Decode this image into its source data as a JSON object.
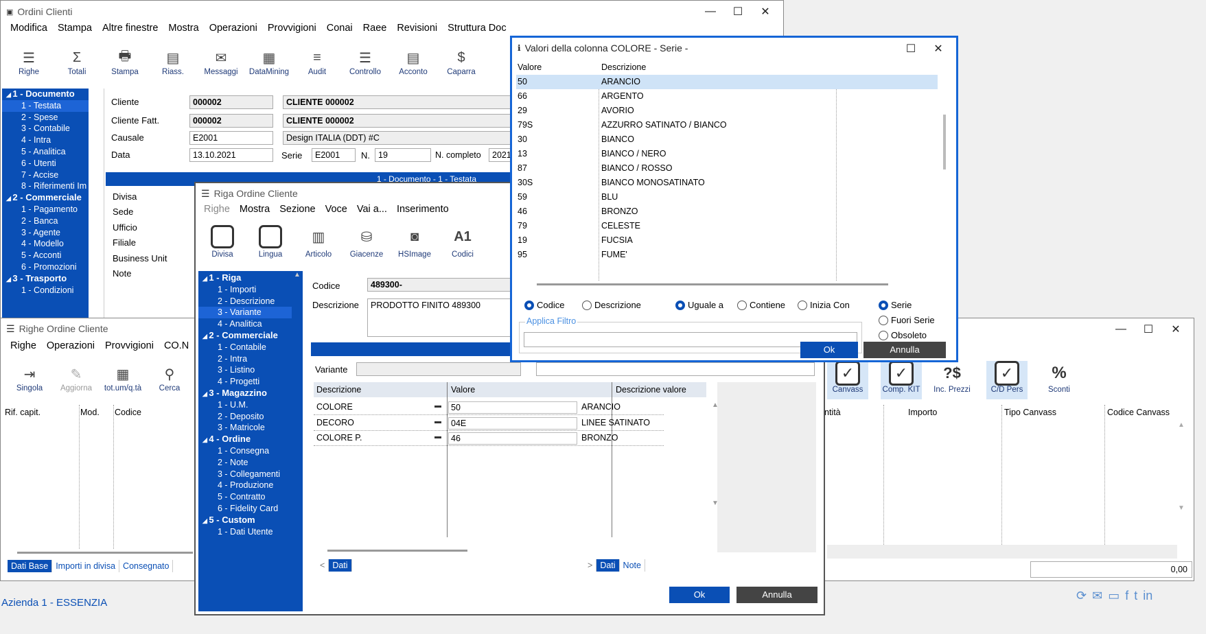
{
  "main": {
    "title": "Ordini Clienti",
    "menu": [
      "Modifica",
      "Stampa",
      "Altre finestre",
      "Mostra",
      "Operazioni",
      "Provvigioni",
      "Conai",
      "Raee",
      "Revisioni",
      "Struttura Doc"
    ],
    "toolbar": [
      "Righe",
      "Totali",
      "Stampa",
      "Riass.",
      "Messaggi",
      "DataMining",
      "Audit",
      "Controllo",
      "Acconto",
      "Caparra"
    ],
    "tree": [
      {
        "label": "1 - Documento",
        "group": true
      },
      {
        "label": "1 - Testata",
        "selected": true
      },
      {
        "label": "2 - Spese"
      },
      {
        "label": "3 - Contabile"
      },
      {
        "label": "4 - Intra"
      },
      {
        "label": "5 - Analitica"
      },
      {
        "label": "6 - Utenti"
      },
      {
        "label": "7 - Accise"
      },
      {
        "label": "8 - Riferimenti Im"
      },
      {
        "label": "2 - Commerciale",
        "group": true
      },
      {
        "label": "1 - Pagamento"
      },
      {
        "label": "2 - Banca"
      },
      {
        "label": "3 - Agente"
      },
      {
        "label": "4 - Modello"
      },
      {
        "label": "5 - Acconti"
      },
      {
        "label": "6 - Promozioni"
      },
      {
        "label": "3 - Trasporto",
        "group": true
      },
      {
        "label": "1 - Condizioni"
      }
    ],
    "cliente_label": "Cliente",
    "cliente_code": "000002",
    "cliente_name": "CLIENTE 000002",
    "cliente_fatt_label": "Cliente Fatt.",
    "cliente_fatt_code": "000002",
    "cliente_fatt_name": "CLIENTE 000002",
    "causale_label": "Causale",
    "causale_code": "E2001",
    "causale_desc": "Design ITALIA (DDT) #C",
    "data_label": "Data",
    "data_value": "13.10.2021",
    "serie_label": "Serie",
    "serie_value": "E2001",
    "n_label": "N.",
    "n_value": "19",
    "ncompleto_label": "N. completo",
    "ncompleto_value": "2021",
    "breadcrumb": "1 - Documento - 1 - Testata",
    "side_labels": [
      "Divisa",
      "Sede",
      "Ufficio",
      "Filiale",
      "Business Unit",
      "Note"
    ]
  },
  "righe": {
    "title": "Righe  Ordine Cliente",
    "menu": [
      "Righe",
      "Operazioni",
      "Provvigioni",
      "CO.N"
    ],
    "toolbar": [
      "Singola",
      "Aggiorna",
      "tot.um/q.tà",
      "Cerca"
    ],
    "columns": [
      "Rif. capit.",
      "Mod.",
      "Codice"
    ],
    "right_buttons": [
      "Canvass",
      "Comp. KIT",
      "Inc. Prezzi",
      "C/D Pers",
      "Sconti"
    ],
    "right_columns": [
      "ntità",
      "Importo",
      "Tipo Canvass",
      "Codice Canvass"
    ],
    "tabs": [
      "Dati Base",
      "Importi in divisa",
      "Consegnato"
    ],
    "total": "0,00"
  },
  "riga": {
    "title": "Riga Ordine Cliente",
    "menu": [
      "Righe",
      "Mostra",
      "Sezione",
      "Voce",
      "Vai a...",
      "Inserimento"
    ],
    "toolbar": [
      "Divisa",
      "Lingua",
      "Articolo",
      "Giacenze",
      "HSImage",
      "Codici"
    ],
    "tree": [
      {
        "label": "1 - Riga",
        "group": true
      },
      {
        "label": "1 - Importi"
      },
      {
        "label": "2 - Descrizione"
      },
      {
        "label": "3 - Variante",
        "selected": true
      },
      {
        "label": "4 - Analitica"
      },
      {
        "label": "2 - Commerciale",
        "group": true
      },
      {
        "label": "1 - Contabile"
      },
      {
        "label": "2 - Intra"
      },
      {
        "label": "3 - Listino"
      },
      {
        "label": "4 - Progetti"
      },
      {
        "label": "3 - Magazzino",
        "group": true
      },
      {
        "label": "1 - U.M."
      },
      {
        "label": "2 - Deposito"
      },
      {
        "label": "3 - Matricole"
      },
      {
        "label": "4 - Ordine",
        "group": true
      },
      {
        "label": "1 - Consegna"
      },
      {
        "label": "2 - Note"
      },
      {
        "label": "3 - Collegamenti"
      },
      {
        "label": "4 - Produzione"
      },
      {
        "label": "5 - Contratto"
      },
      {
        "label": "6 - Fidelity Card"
      },
      {
        "label": "5 - Custom",
        "group": true
      },
      {
        "label": "1 - Dati Utente"
      }
    ],
    "codice_label": "Codice",
    "codice_value": "489300-",
    "descr_label": "Descrizione",
    "descr_value": "PRODOTTO FINITO 489300",
    "variante_label": "Variante",
    "grid_headers": [
      "Descrizione",
      "Valore",
      "Descrizione valore"
    ],
    "grid_rows": [
      {
        "desc": "COLORE",
        "val": "50",
        "dval": "ARANCIO"
      },
      {
        "desc": "DECORO",
        "val": "04E",
        "dval": "LINEE SATINATO"
      },
      {
        "desc": "COLORE P.",
        "val": "46",
        "dval": "BRONZO"
      }
    ],
    "tab_left": "Dati",
    "tab_right": [
      "Dati",
      "Note"
    ],
    "ok": "Ok",
    "annulla": "Annulla"
  },
  "valori": {
    "title": "Valori della colonna COLORE - Serie -",
    "headers": [
      "Valore",
      "Descrizione"
    ],
    "rows": [
      {
        "v": "50",
        "d": "ARANCIO"
      },
      {
        "v": "66",
        "d": "ARGENTO"
      },
      {
        "v": "29",
        "d": "AVORIO"
      },
      {
        "v": "79S",
        "d": "AZZURRO SATINATO / BIANCO"
      },
      {
        "v": "30",
        "d": "BIANCO"
      },
      {
        "v": "13",
        "d": "BIANCO / NERO"
      },
      {
        "v": "87",
        "d": "BIANCO / ROSSO"
      },
      {
        "v": "30S",
        "d": "BIANCO MONOSATINATO"
      },
      {
        "v": "59",
        "d": "BLU"
      },
      {
        "v": "46",
        "d": "BRONZO"
      },
      {
        "v": "79",
        "d": "CELESTE"
      },
      {
        "v": "19",
        "d": "FUCSIA"
      },
      {
        "v": "95",
        "d": "FUME'"
      }
    ],
    "radio_field": [
      "Codice",
      "Descrizione"
    ],
    "radio_match": [
      "Uguale a",
      "Contiene",
      "Inizia Con"
    ],
    "radio_serie": [
      "Serie",
      "Fuori Serie",
      "Obsoleto"
    ],
    "filter_label": "Applica Filtro",
    "ok": "Ok",
    "annulla": "Annulla"
  },
  "footer": {
    "azienda": "Azienda  1 - ESSENZIA"
  },
  "colors": {
    "accent": "#0a4fb5",
    "selected_row": "#cfe3f7"
  }
}
